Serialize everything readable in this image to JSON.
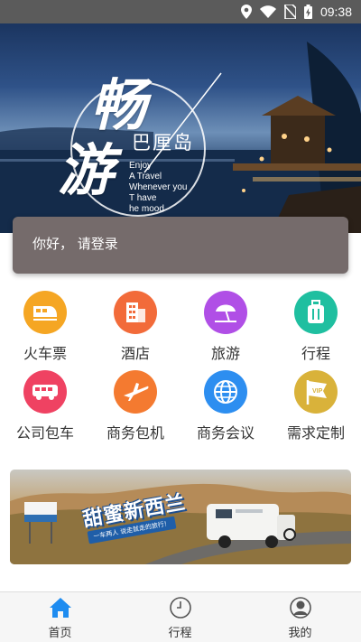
{
  "status_bar": {
    "time": "09:38",
    "icons": [
      "location-icon",
      "wifi-icon",
      "no-sim-icon",
      "battery-charging-icon"
    ]
  },
  "hero": {
    "title_chars": [
      "畅",
      "游"
    ],
    "subtitle": "巴厘岛",
    "tagline": [
      "Enjoy",
      "A Travel",
      "Whenever you",
      "T have",
      "he mood"
    ]
  },
  "login_card": {
    "text": "你好， 请登录"
  },
  "services": [
    {
      "label": "火车票",
      "icon": "train-icon",
      "color": "#f5a623"
    },
    {
      "label": "酒店",
      "icon": "hotel-icon",
      "color": "#f26b3a"
    },
    {
      "label": "旅游",
      "icon": "beach-umbrella-icon",
      "color": "#b04fe6"
    },
    {
      "label": "行程",
      "icon": "luggage-icon",
      "color": "#1fbfa0"
    },
    {
      "label": "公司包车",
      "icon": "bus-icon",
      "color": "#ef4262"
    },
    {
      "label": "商务包机",
      "icon": "airplane-icon",
      "color": "#f47a30"
    },
    {
      "label": "商务会议",
      "icon": "globe-icon",
      "color": "#2d8ef0"
    },
    {
      "label": "需求定制",
      "icon": "vip-flag-icon",
      "color": "#d9b23a"
    }
  ],
  "banner": {
    "title": "甜蜜新西兰",
    "subtitle": "一车两人 说走就走的旅行！"
  },
  "tabbar": {
    "items": [
      {
        "label": "首页",
        "icon": "home-icon",
        "active": true
      },
      {
        "label": "行程",
        "icon": "clock-icon",
        "active": false
      },
      {
        "label": "我的",
        "icon": "user-icon",
        "active": false
      }
    ],
    "active_color": "#1e8cf0"
  }
}
